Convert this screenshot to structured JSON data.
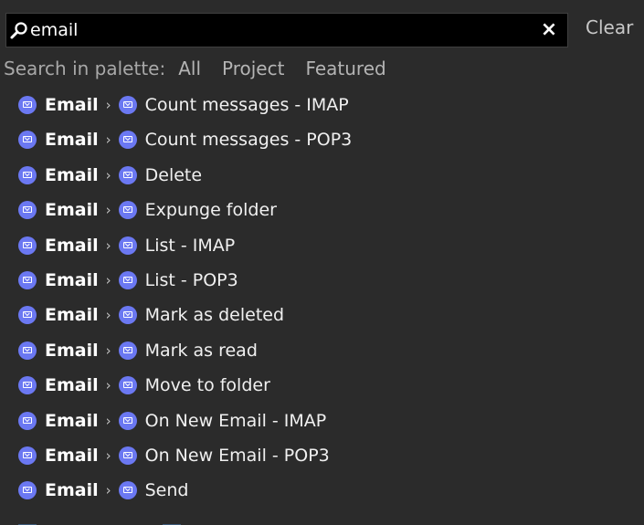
{
  "search": {
    "value": "email",
    "clear_label": "Clear"
  },
  "scope": {
    "label": "Search in palette:",
    "options": [
      "All",
      "Project",
      "Featured"
    ]
  },
  "results": [
    {
      "category": "Email",
      "item": "Count messages - IMAP"
    },
    {
      "category": "Email",
      "item": "Count messages - POP3"
    },
    {
      "category": "Email",
      "item": "Delete"
    },
    {
      "category": "Email",
      "item": "Expunge folder"
    },
    {
      "category": "Email",
      "item": "List - IMAP"
    },
    {
      "category": "Email",
      "item": "List - POP3"
    },
    {
      "category": "Email",
      "item": "Mark as deleted"
    },
    {
      "category": "Email",
      "item": "Mark as read"
    },
    {
      "category": "Email",
      "item": "Move to folder"
    },
    {
      "category": "Email",
      "item": "On New Email - IMAP"
    },
    {
      "category": "Email",
      "item": "On New Email - POP3"
    },
    {
      "category": "Email",
      "item": "Send"
    }
  ],
  "colors": {
    "background": "#2b2b2b",
    "search_background": "#000000",
    "email_badge": "#6b78f2"
  },
  "icons": {
    "search": "magnifier-icon",
    "clear": "close-icon",
    "result": "email-icon",
    "separator": "chevron-right-icon"
  }
}
